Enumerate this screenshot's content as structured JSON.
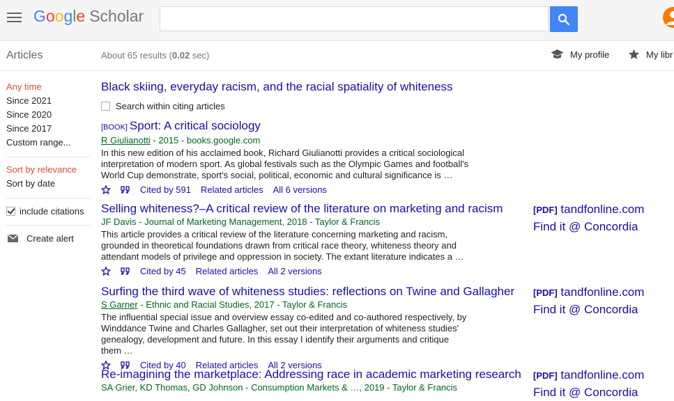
{
  "header": {
    "logo_text": [
      "G",
      "o",
      "o",
      "g",
      "l",
      "e"
    ],
    "logo_suffix": "Scholar",
    "search_value": ""
  },
  "subbar": {
    "section": "Articles",
    "results_prefix": "About 65 results (",
    "results_time": "0.02",
    "results_suffix": " sec)",
    "my_profile": "My profile",
    "my_library": "My libr"
  },
  "sidebar": {
    "time": [
      "Any time",
      "Since 2021",
      "Since 2020",
      "Since 2017",
      "Custom range..."
    ],
    "sort": [
      "Sort by relevance",
      "Sort by date"
    ],
    "include_citations": "include citations",
    "create_alert": "Create alert"
  },
  "cited": {
    "title": "Black skiing, everyday racism, and the racial spatiality of whiteness",
    "search_within": "Search within citing articles"
  },
  "results": [
    {
      "tag": "[BOOK]",
      "title": "Sport: A critical sociology",
      "author": "R Giulianotti",
      "meta": " - 2015 - books.google.com",
      "snippet": "In this new edition of his acclaimed book, Richard Giulianotti provides a critical sociological interpretation of modern sport. As global festivals such as the Olympic Games and football's World Cup demonstrate, sport's social, political, economic and cultural significance is …",
      "cited_by": "Cited by 591",
      "related": "Related articles",
      "versions": "All 6 versions"
    },
    {
      "tag": "",
      "title": "Selling whiteness?–A critical review of the literature on marketing and racism",
      "author": "",
      "meta": "JF Davis - Journal of Marketing Management, 2018 - Taylor & Francis",
      "snippet": "This article provides a critical review of the literature concerning marketing and racism, grounded in theoretical foundations drawn from critical race theory, whiteness theory and attendant models of privilege and oppression in society. The extant literature indicates a …",
      "cited_by": "Cited by 45",
      "related": "Related articles",
      "versions": "All 2 versions",
      "pdf_tag": "[PDF]",
      "pdf_source": "tandfonline.com",
      "findit": "Find it @ Concordia"
    },
    {
      "tag": "",
      "title": "Surfing the third wave of whiteness studies: reflections on Twine and Gallagher",
      "author": "S Garner",
      "meta": " - Ethnic and Racial Studies, 2017 - Taylor & Francis",
      "snippet": "The influential special issue and overview essay co-edited and co-authored respectively, by Winddance Twine and Charles Gallagher, set out their interpretation of whiteness studies' genealogy, development and future. In this essay I identify their arguments and critique them …",
      "cited_by": "Cited by 40",
      "related": "Related articles",
      "versions": "All 2 versions",
      "pdf_tag": "[PDF]",
      "pdf_source": "tandfonline.com",
      "findit": "Find it @ Concordia"
    },
    {
      "tag": "",
      "title": "Re-imagining the marketplace: Addressing race in academic marketing research",
      "author": "",
      "meta": "SA Grier, KD Thomas, GD Johnson - Consumption Markets & …, 2019 - Taylor & Francis",
      "pdf_tag": "[PDF]",
      "pdf_source": "tandfonline.com",
      "findit": "Find it @ Concordia"
    }
  ]
}
